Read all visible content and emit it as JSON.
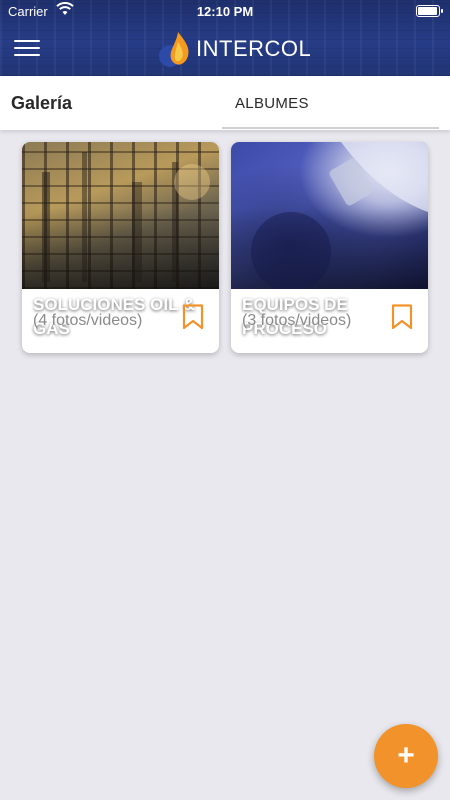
{
  "status_bar": {
    "carrier": "Carrier",
    "time": "12:10 PM",
    "battery_level": 0.95
  },
  "header": {
    "logo_text": "INTERCOL",
    "menu_icon": "hamburger-menu-icon"
  },
  "tabbar": {
    "title": "Galería",
    "tab_label": "ALBUMES"
  },
  "albums": [
    {
      "title": "SOLUCIONES OIL & GAS",
      "count": "(4 fotos/videos)",
      "icon": "bookmark-icon"
    },
    {
      "title": "EQUIPOS DE PROCESO",
      "count": "(3 fotos/videos)",
      "icon": "bookmark-icon"
    }
  ],
  "fab": {
    "label": "+"
  },
  "colors": {
    "accent": "#f2922b",
    "header": "#263c86",
    "background": "#e8e8ee"
  }
}
